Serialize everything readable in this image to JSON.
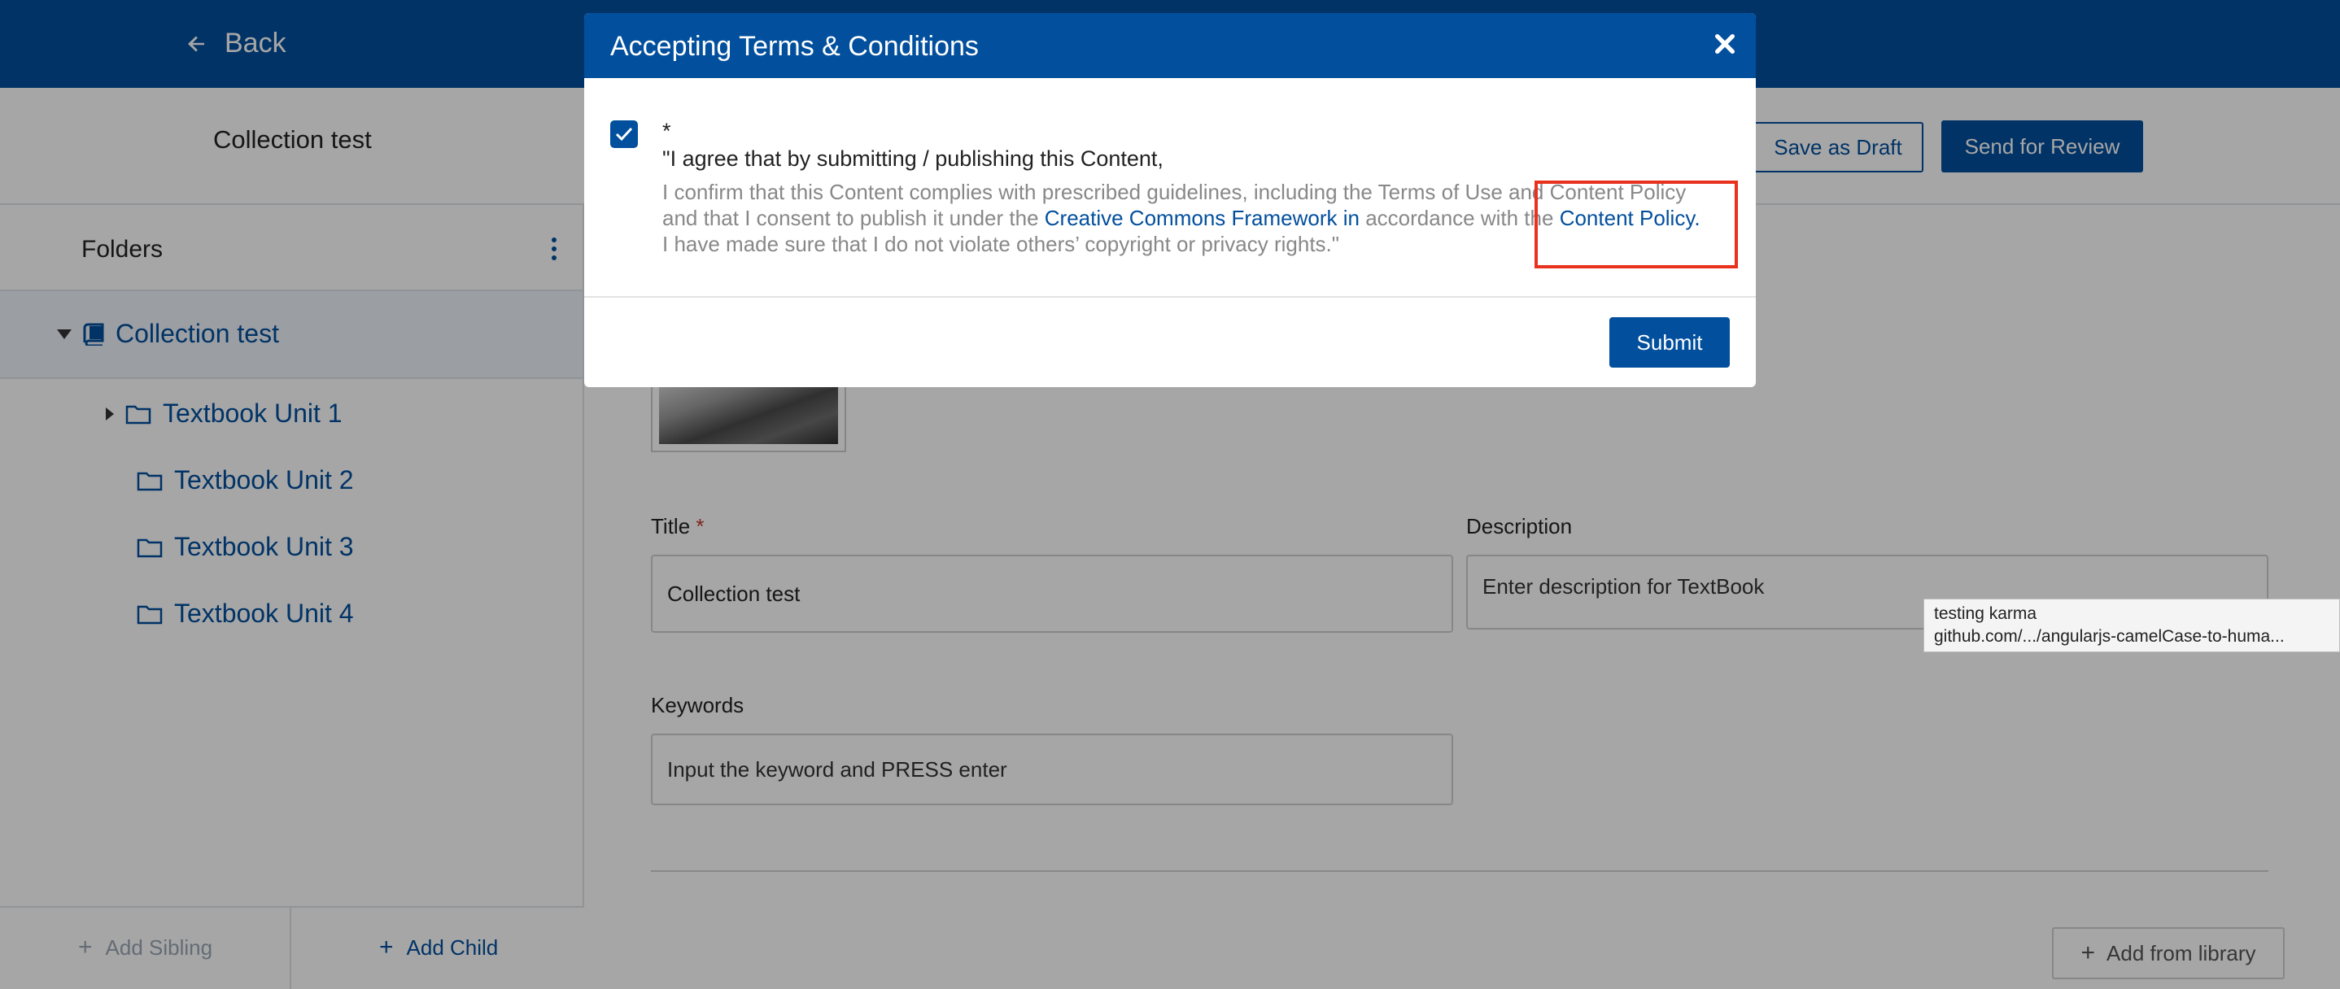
{
  "header": {
    "back_label": "Back"
  },
  "subheader": {
    "title": "Collection test",
    "save_draft_label": "Save as Draft",
    "send_review_label": "Send for Review"
  },
  "sidebar": {
    "folders_label": "Folders",
    "root": {
      "label": "Collection test"
    },
    "items": [
      {
        "label": "Textbook Unit 1"
      },
      {
        "label": "Textbook Unit 2"
      },
      {
        "label": "Textbook Unit 3"
      },
      {
        "label": "Textbook Unit 4"
      }
    ],
    "add_sibling_label": "Add Sibling",
    "add_child_label": "Add Child"
  },
  "form": {
    "title_label": "Title",
    "title_required_mark": "*",
    "title_value": "Collection test",
    "description_label": "Description",
    "description_placeholder": "Enter description for TextBook",
    "keywords_label": "Keywords",
    "keywords_placeholder": "Input the keyword and PRESS enter",
    "add_from_library_label": "Add from library"
  },
  "tooltip": {
    "line1": "testing karma",
    "line2": "github.com/.../angularjs-camelCase-to-huma..."
  },
  "modal": {
    "title": "Accepting Terms & Conditions",
    "checkbox_checked": true,
    "required_mark": "*",
    "agree_main": "\"I agree that by submitting / publishing this Content,",
    "body_line1": "I confirm that this Content complies with prescribed guidelines, including the Terms of Use and Content Policy",
    "body_line2_pre": "and that I consent to publish it under the ",
    "body_link1": "Creative Commons Framework in",
    "body_line2_mid": " accordance with the ",
    "body_link2": "Content Policy.",
    "body_line3": "I have made sure that I do not violate others’ copyright or privacy rights.\"",
    "submit_label": "Submit"
  },
  "colors": {
    "primary": "#024f9d",
    "highlight": "#e8321e",
    "muted_text": "#888888"
  }
}
